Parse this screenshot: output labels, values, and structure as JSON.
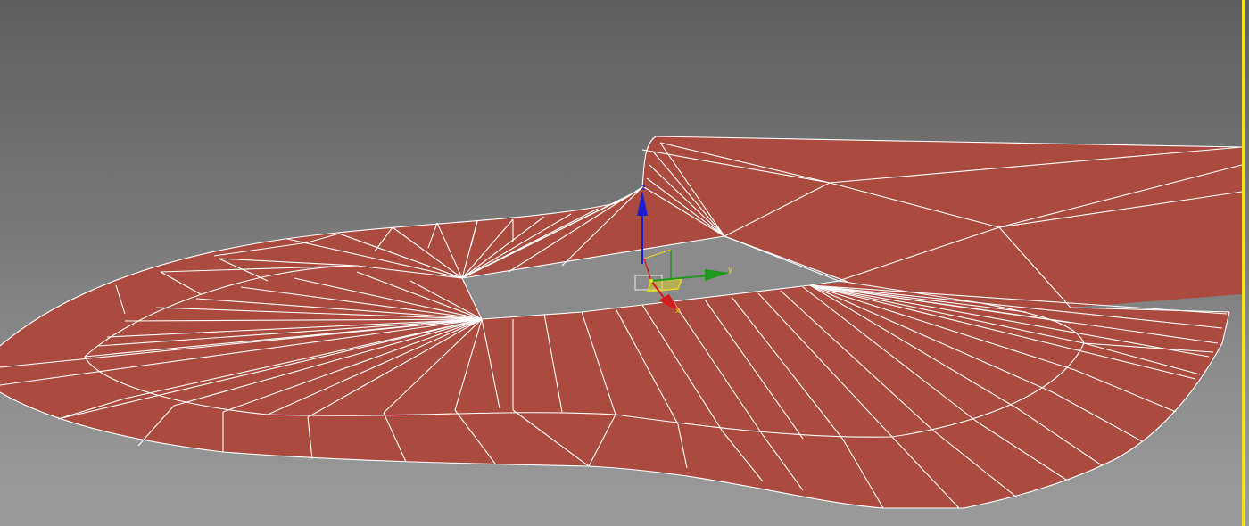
{
  "viewport": {
    "background_top": "#5f5f5f",
    "background_bottom": "#9b9b9b",
    "active_border_color": "#f4e219"
  },
  "mesh": {
    "face_color": "#ab4a3e",
    "wire_color": "#ffffff"
  },
  "gizmo": {
    "axes": [
      {
        "name": "z",
        "label": "z",
        "color": "#1d1dd0"
      },
      {
        "name": "y",
        "label": "y",
        "color": "#1f9a1f"
      },
      {
        "name": "x",
        "label": "x",
        "color": "#d21e1e"
      }
    ],
    "plane_color": "#e8d91a"
  }
}
